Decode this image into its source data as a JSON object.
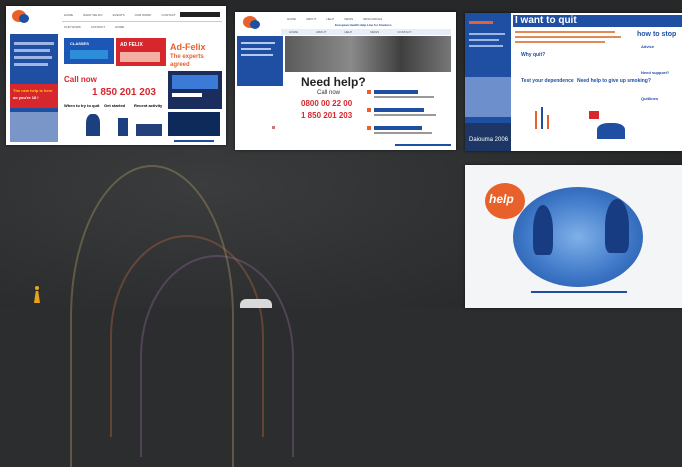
{
  "panels": {
    "p1": {
      "nav": [
        "HOME",
        "WHAT WE DO",
        "EVENTS",
        "OUR WORK",
        "CONTACT",
        "LINKS"
      ],
      "tabs": [
        "CLASSES",
        "AD FELIX"
      ],
      "headline": "Ad-Felix",
      "subline": "The experts",
      "subline2": "agreed",
      "call_now": "Call now",
      "phone": "1 850 201 203",
      "side_label": "The new help is here",
      "side_label2": "so you're 18 !",
      "promo1": "When to try to quit",
      "promo2": "Get started",
      "promo3": "Recent activity"
    },
    "p2": {
      "nav": [
        "HOME",
        "ABOUT",
        "HELP",
        "NEWS",
        "RESOURCES",
        "CONTACT"
      ],
      "banner": "European Health Help Line for Smokers",
      "title": "Need help?",
      "call_now": "Call now",
      "phone1": "0800 00 22 00",
      "phone2": "1 850 201 203"
    },
    "p3": {
      "title": "I want to quit",
      "title2": "how to stop",
      "h1": "Why quit?",
      "h2": "Test your dependence",
      "h3": "Need help to give up smoking?",
      "r1": "Advice",
      "r2": "Need support?",
      "r3": "Quitlines",
      "footer": "Daiouma 2006"
    },
    "p4": {
      "logo": "help"
    }
  },
  "colors": {
    "brand_blue": "#1f4fa3",
    "brand_orange": "#e8612a",
    "brand_red": "#d8262d",
    "bg": "#2b2d2e"
  }
}
